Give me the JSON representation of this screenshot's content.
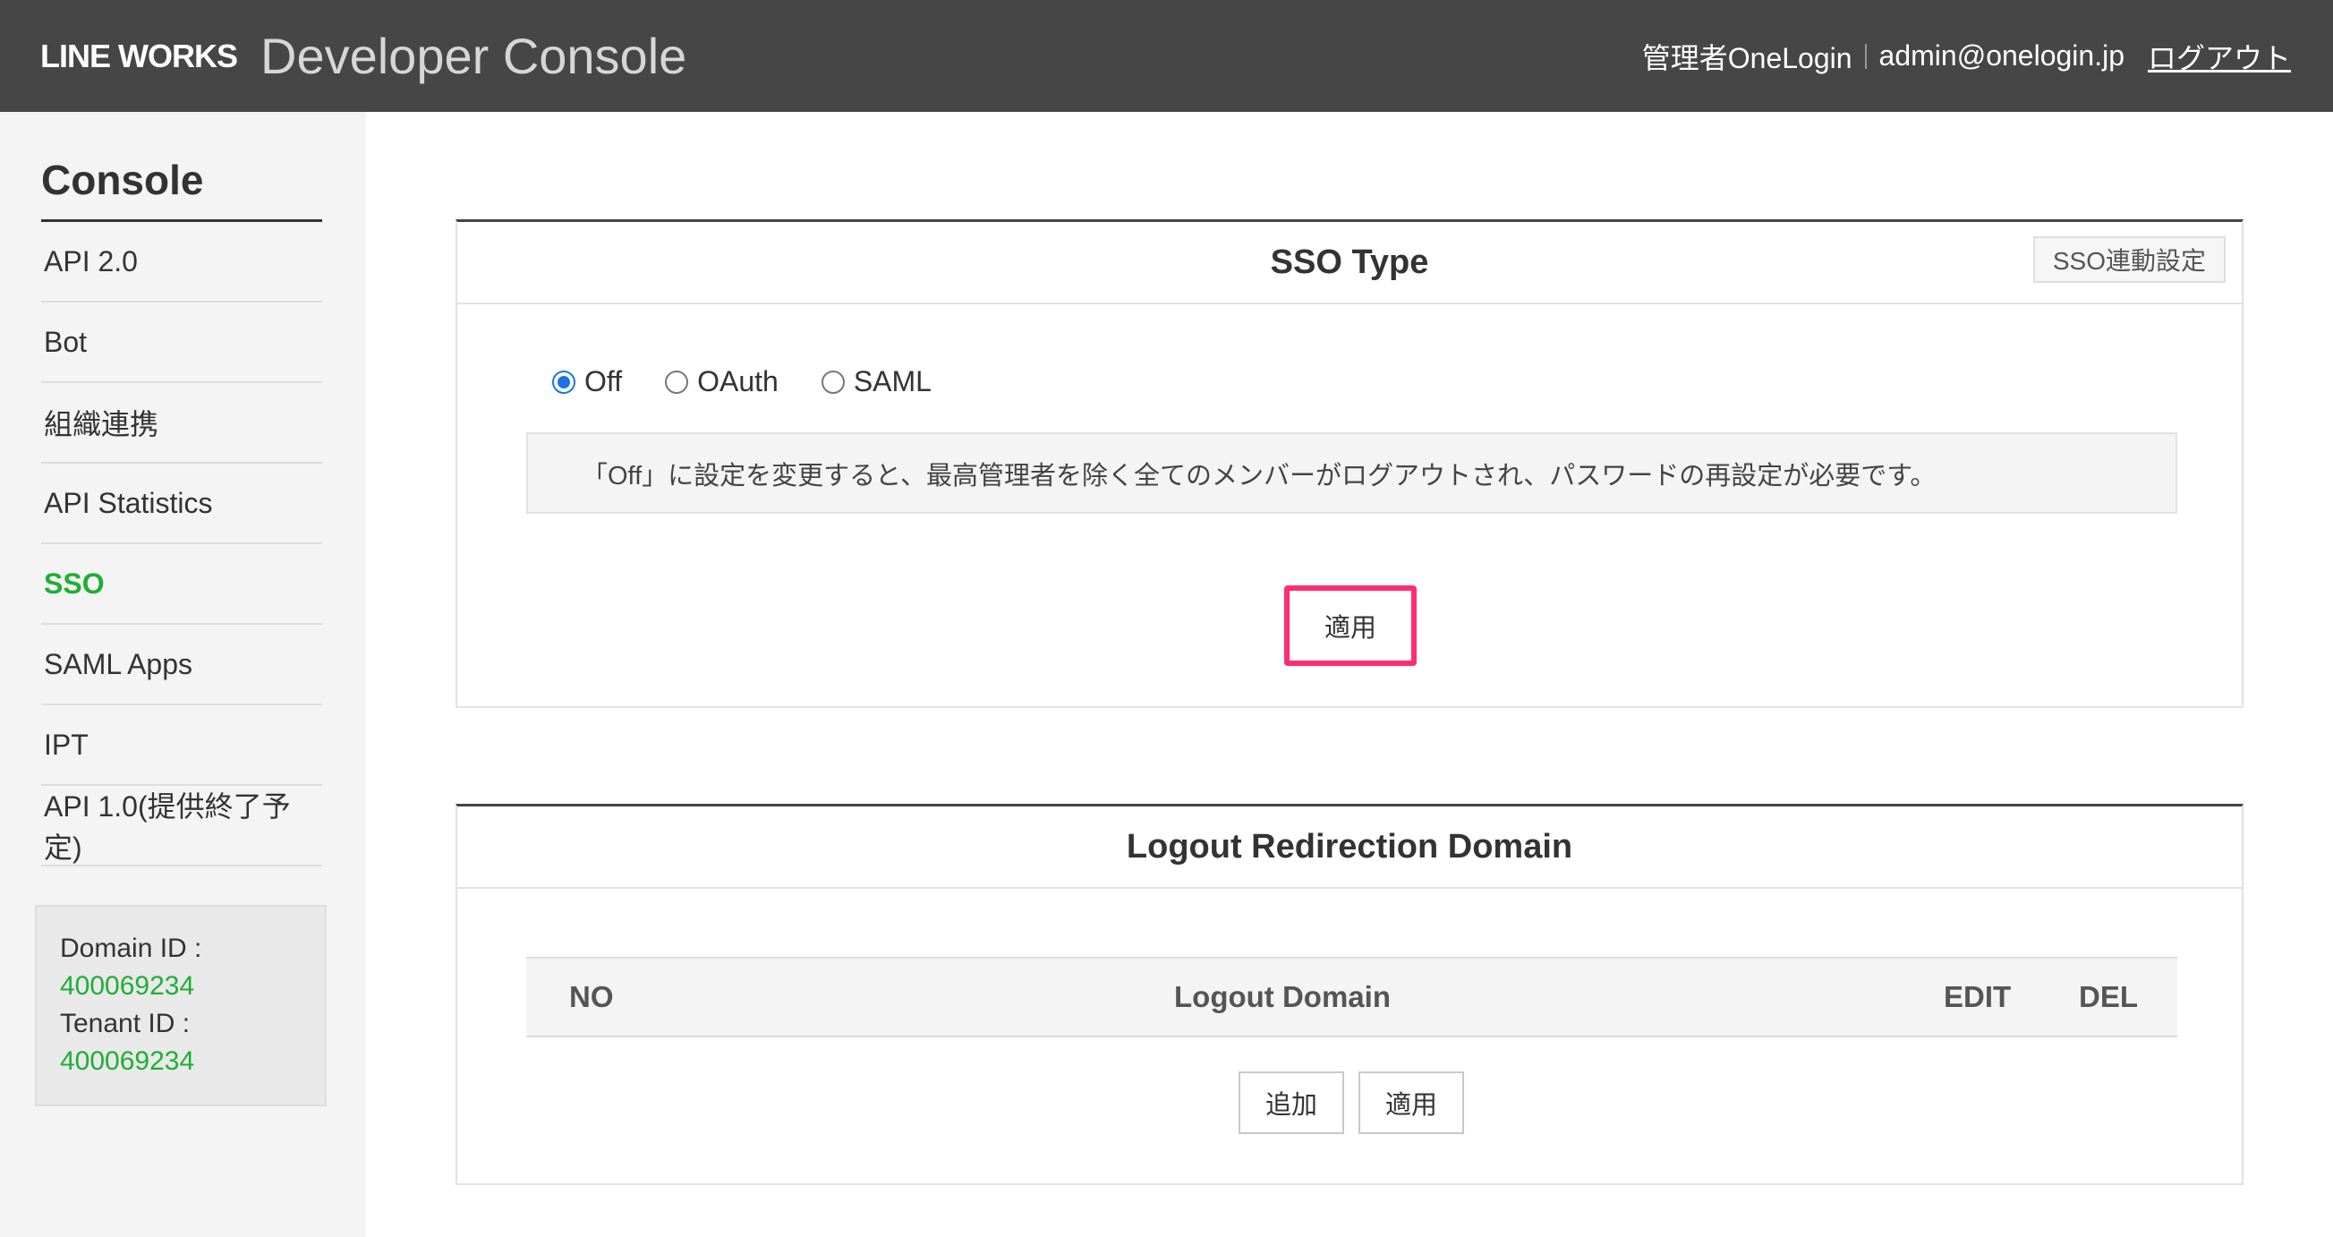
{
  "header": {
    "brand_logo": "LINE WORKS",
    "brand_title": "Developer Console",
    "admin_name": "管理者OneLogin",
    "admin_email": "admin@onelogin.jp",
    "logout_label": "ログアウト"
  },
  "sidebar": {
    "title": "Console",
    "items": [
      {
        "label": "API 2.0"
      },
      {
        "label": "Bot"
      },
      {
        "label": "組織連携"
      },
      {
        "label": "API Statistics"
      },
      {
        "label": "SSO"
      },
      {
        "label": "SAML Apps"
      },
      {
        "label": "IPT"
      },
      {
        "label": "API 1.0(提供終了予定)"
      }
    ],
    "active_item": "SSO",
    "domain_id_label": "Domain ID :",
    "domain_id_value": "400069234",
    "tenant_id_label": "Tenant ID :",
    "tenant_id_value": "400069234"
  },
  "sso_panel": {
    "title": "SSO Type",
    "settings_button": "SSO連動設定",
    "options": [
      {
        "label": "Off",
        "checked": true
      },
      {
        "label": "OAuth",
        "checked": false
      },
      {
        "label": "SAML",
        "checked": false
      }
    ],
    "notice": "「Off」に設定を変更すると、最高管理者を除く全てのメンバーがログアウトされ、パスワードの再設定が必要です。",
    "apply_label": "適用"
  },
  "logout_panel": {
    "title": "Logout Redirection Domain",
    "columns": [
      "NO",
      "Logout Domain",
      "EDIT",
      "DEL"
    ],
    "add_label": "追加",
    "apply_label": "適用"
  },
  "colors": {
    "header_bg": "#464646",
    "sidebar_bg": "#f4f4f4",
    "accent_green": "#1fae34",
    "radio_blue": "#1a73e8",
    "highlight_pink": "#ff2d6f"
  }
}
